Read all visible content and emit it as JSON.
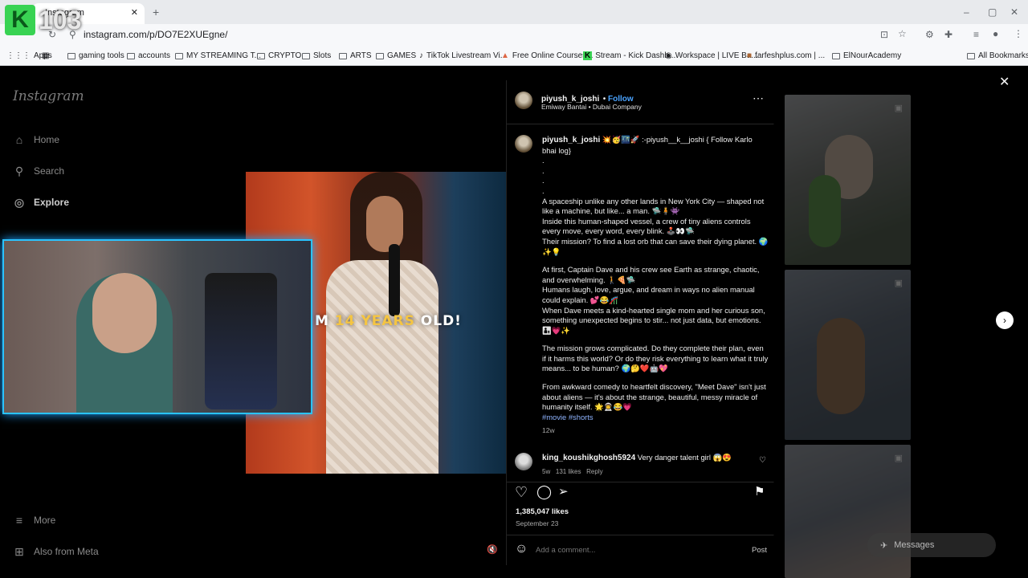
{
  "browser": {
    "tab_title": "Instagram",
    "url": "instagram.com/p/DO7E2XUEgne/",
    "bookmarks": [
      "Apps",
      "gaming tools",
      "accounts",
      "MY STREAMING T...",
      "CRYPTO",
      "Slots",
      "ARTS",
      "GAMES",
      "TikTok Livestream Vi...",
      "Free Online Courses...",
      "Stream - Kick Dashb...",
      "Workspace | LIVE Ba...",
      "farfeshplus.com | ...",
      "ElNourAcademy"
    ],
    "all_bookmarks": "All Bookmarks"
  },
  "overlay": {
    "badge_letter": "K",
    "badge_number": "103"
  },
  "sidebar": {
    "logo": "Instagram",
    "items": [
      {
        "label": "Home",
        "icon": "home-icon"
      },
      {
        "label": "Search",
        "icon": "search-icon"
      },
      {
        "label": "Explore",
        "icon": "explore-icon"
      }
    ],
    "more": "More",
    "meta": "Also from Meta"
  },
  "video": {
    "overlay_text_a": "M",
    "overlay_text_b": "14",
    "overlay_text_c": "YEARS",
    "overlay_text_d": "OLD!"
  },
  "post": {
    "header": {
      "username": "piyush_k_joshi",
      "follow": "Follow",
      "subtitle": "Emiway Bantai • Dubai Company"
    },
    "caption": {
      "username": "piyush_k_joshi",
      "intro": "💥🥳🌃🚀 :-piyush__k__joshi { Follow Karlo bhai log}",
      "dots": [
        ".",
        ".",
        ".",
        "."
      ],
      "paragraphs": [
        "A spaceship unlike any other lands in New York City — shaped not like a machine, but like... a man. 🛸🧍👾",
        "Inside this human-shaped vessel, a crew of tiny aliens controls every move, every word, every blink. 🕹️👀🛸",
        "Their mission? To find a lost orb that can save their dying planet. 🌍✨💡",
        "At first, Captain Dave and his crew see Earth as strange, chaotic, and overwhelming. 🚶🍕🛸",
        "Humans laugh, love, argue, and dream in ways no alien manual could explain. 💕😂🎢",
        "When Dave meets a kind-hearted single mom and her curious son, something unexpected begins to stir... not just data, but emotions. 👨‍👦💗✨",
        "The mission grows complicated. Do they complete their plan, even if it harms this world? Or do they risk everything to learn what it truly means... to be human? 🌍🤔❤️🤖💖",
        "From awkward comedy to heartfelt discovery, \"Meet Dave\" isn't just about aliens — it's about the strange, beautiful, messy miracle of humanity itself. 🌟👨‍🚀😂💗"
      ],
      "hashtags": "#movie #shorts",
      "age": "12w"
    },
    "comment": {
      "username": "king_koushikghosh5924",
      "text": "Very danger talent girl 😱😍",
      "age": "5w",
      "likes": "131 likes",
      "reply": "Reply"
    },
    "likes": "1,385,047 likes",
    "date": "September 23",
    "add_comment": "Add a comment...",
    "post_button": "Post"
  },
  "messages": {
    "label": "Messages"
  }
}
